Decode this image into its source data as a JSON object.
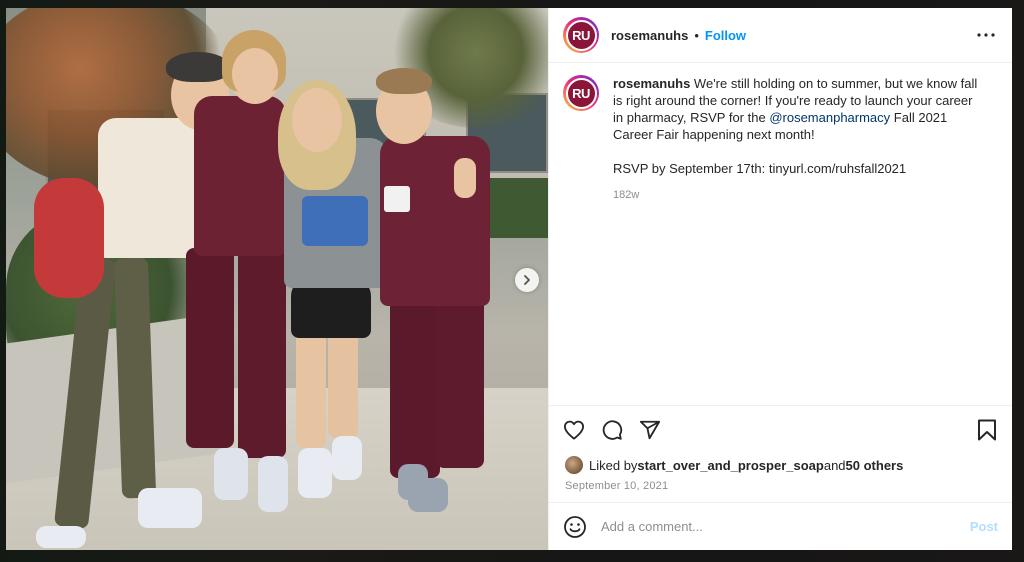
{
  "post": {
    "username": "rosemanuhs",
    "avatar_initials": "RU",
    "separator": "•",
    "follow_label": "Follow",
    "caption_username": "rosemanuhs",
    "caption_part1": " We're still holding on to summer, but we know fall is right around the corner! If you're ready to launch your career in pharmacy, RSVP for the ",
    "caption_mention": "@rosemanpharmacy",
    "caption_part2": " Fall 2021 Career Fair happening next month!\n\nRSVP by September 17th: tinyurl.com/ruhsfall2021",
    "time_ago": "182w",
    "liked_by_prefix": "Liked by ",
    "liked_by_user": "start_over_and_prosper_soap",
    "liked_by_and": " and ",
    "liked_by_others": "50 others",
    "date": "September 10, 2021",
    "comment_placeholder": "Add a comment...",
    "post_label": "Post"
  },
  "icons": {
    "more": "more-options-icon",
    "like": "heart-icon",
    "comment": "comment-icon",
    "share": "share-icon",
    "save": "bookmark-icon",
    "emoji": "emoji-icon",
    "next": "chevron-right-icon"
  },
  "colors": {
    "follow": "#0095f6",
    "mention": "#00376b",
    "post_button_disabled": "#b2dffc",
    "avatar_bg": "#8a1538"
  }
}
